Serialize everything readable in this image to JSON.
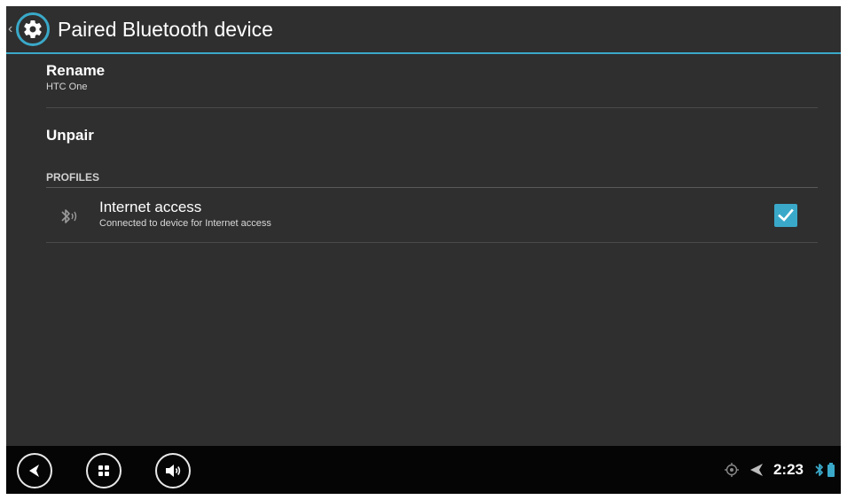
{
  "header": {
    "title": "Paired Bluetooth device",
    "back_icon": "chevron-left-icon",
    "settings_icon": "gear-icon",
    "accent_color": "#3aa9c9"
  },
  "items": {
    "rename": {
      "title": "Rename",
      "subtitle": "HTC One"
    },
    "unpair": {
      "title": "Unpair"
    }
  },
  "profiles": {
    "section_label": "PROFILES",
    "internet_access": {
      "title": "Internet access",
      "subtitle": "Connected to device for Internet access",
      "icon": "bluetooth-icon",
      "checked": true
    }
  },
  "bottom_bar": {
    "buttons": [
      {
        "icon": "back-arrow-icon"
      },
      {
        "icon": "grid-menu-icon"
      },
      {
        "icon": "volume-icon"
      }
    ],
    "status": {
      "time": "2:23",
      "icons": [
        "gps-icon",
        "navigation-arrow-icon",
        "bluetooth-icon",
        "battery-icon"
      ]
    }
  }
}
